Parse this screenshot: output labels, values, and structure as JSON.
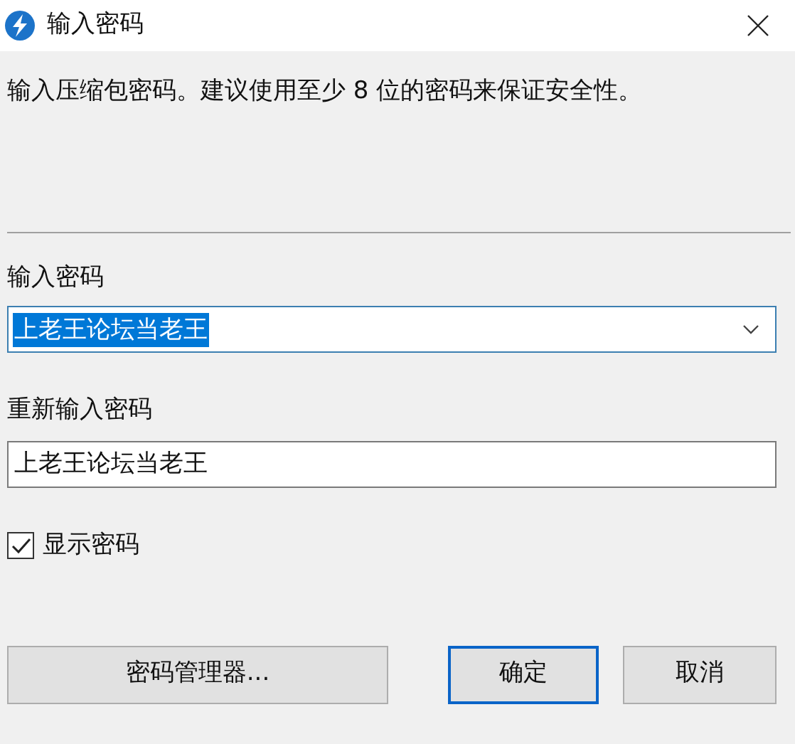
{
  "window": {
    "title": "输入密码"
  },
  "description": "输入压缩包密码。建议使用至少 8 位的密码来保证安全性。",
  "password": {
    "label": "输入密码",
    "value": "上老王论坛当老王",
    "text_selected": true
  },
  "confirm": {
    "label": "重新输入密码",
    "value": "上老王论坛当老王"
  },
  "show_password": {
    "label": "显示密码",
    "checked": true
  },
  "buttons": [
    {
      "label": "密码管理器...",
      "default": false
    },
    {
      "label": "确定",
      "default": true
    },
    {
      "label": "取消",
      "default": false
    }
  ]
}
